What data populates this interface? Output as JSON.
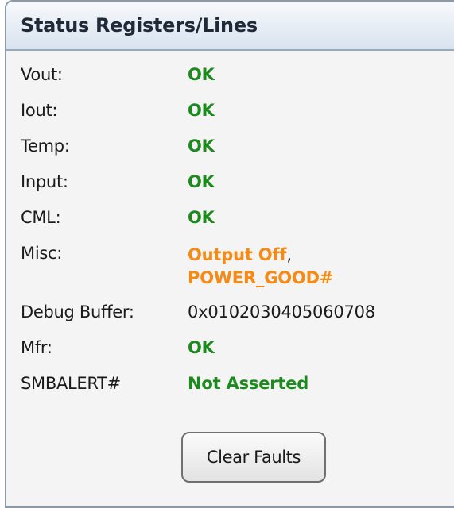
{
  "panel": {
    "title": "Status Registers/Lines"
  },
  "rows": [
    {
      "label": "Vout:",
      "value": "OK",
      "status": "ok"
    },
    {
      "label": "Iout:",
      "value": "OK",
      "status": "ok"
    },
    {
      "label": "Temp:",
      "value": "OK",
      "status": "ok"
    },
    {
      "label": "Input:",
      "value": "OK",
      "status": "ok"
    },
    {
      "label": "CML:",
      "value": "OK",
      "status": "ok"
    },
    {
      "label": "Misc:",
      "value_line1": "Output Off",
      "separator": ",",
      "value_line2": "POWER_GOOD#",
      "status": "warning"
    },
    {
      "label": "Debug Buffer:",
      "value": "0x0102030405060708",
      "status": "plain"
    },
    {
      "label": "Mfr:",
      "value": "OK",
      "status": "ok"
    },
    {
      "label": "SMBALERT#",
      "value": "Not Asserted",
      "status": "ok"
    }
  ],
  "buttons": {
    "clear_faults": "Clear Faults"
  },
  "colors": {
    "ok": "#1d8a1d",
    "warning": "#f58a14",
    "header_bg": "#d9e3ef",
    "panel_bg": "#f4f4f4",
    "border": "#8c9aa8"
  }
}
